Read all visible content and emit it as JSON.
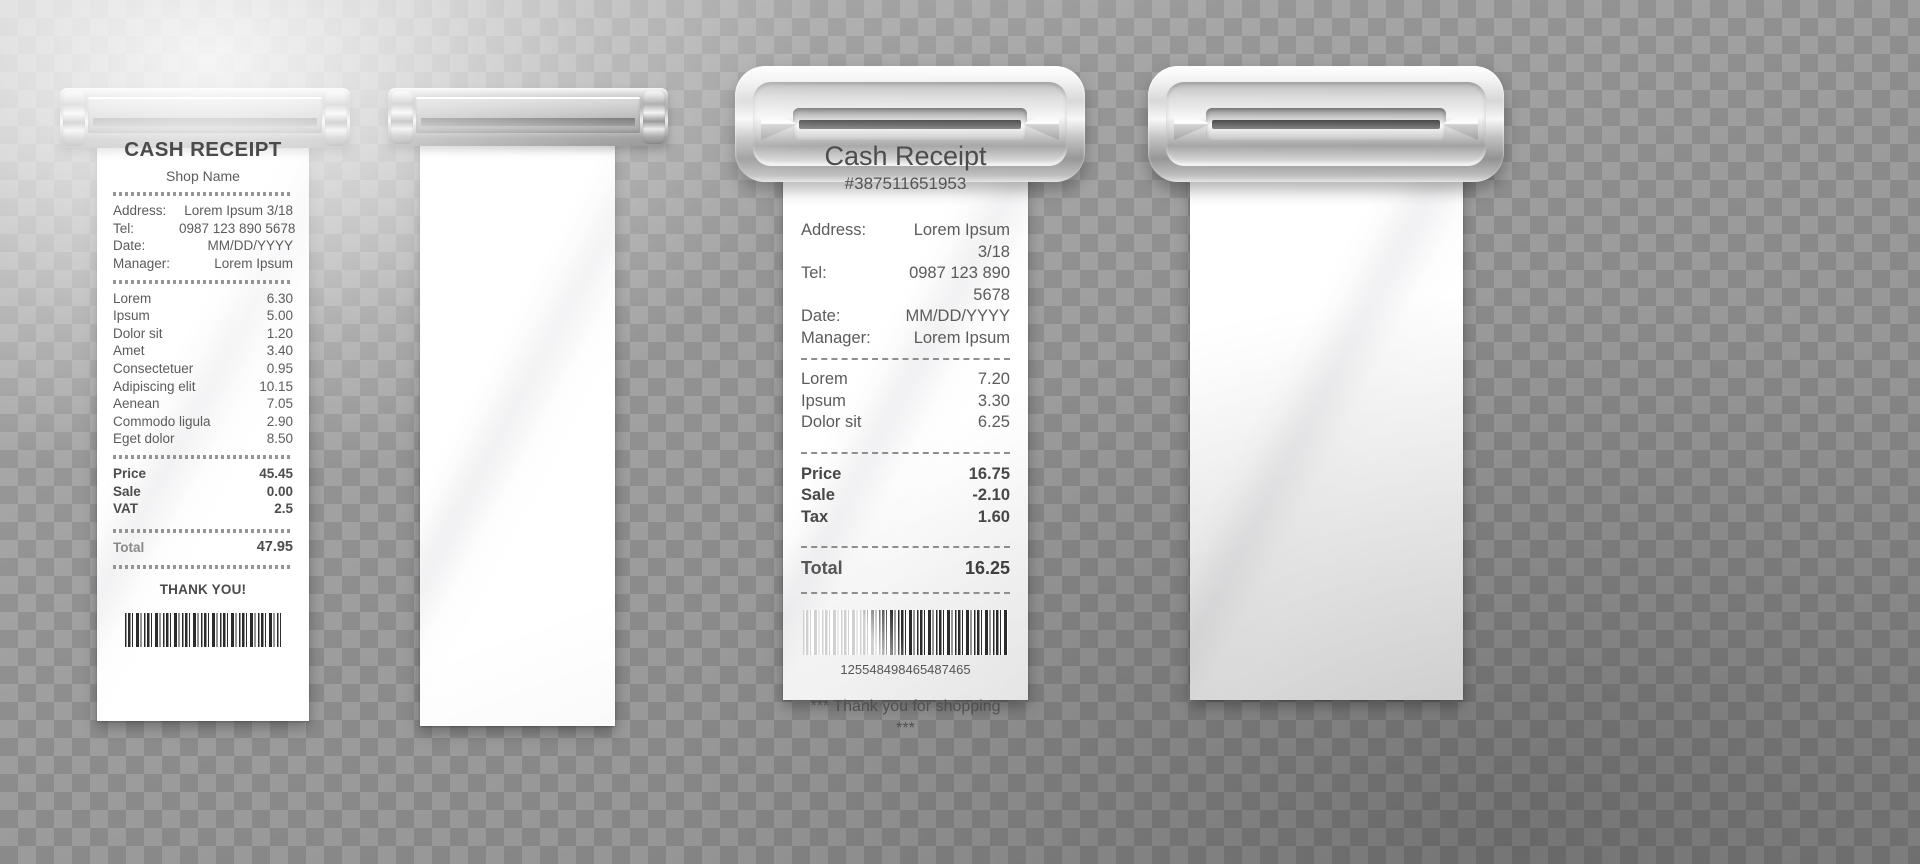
{
  "scene": {
    "title": "Cash receipt printer slots with printed and blank thermal paper",
    "background": "transparent-checkerboard",
    "accent_color": "#5b5b5b",
    "paper_color": "#ffffff",
    "chrome_color": "#bdbdbd"
  },
  "receipts": [
    {
      "id": "receipt-printed-bold",
      "slot_style": "thin-chrome-bar",
      "title": "CASH RECEIPT",
      "shop": "Shop Name",
      "info": [
        {
          "label": "Address:",
          "value": "Lorem Ipsum 3/18"
        },
        {
          "label": "Tel:",
          "value": "0987 123 890 5678"
        },
        {
          "label": "Date:",
          "value": "MM/DD/YYYY"
        },
        {
          "label": "Manager:",
          "value": "Lorem Ipsum"
        }
      ],
      "items": [
        {
          "name": "Lorem",
          "price": "6.30"
        },
        {
          "name": "Ipsum",
          "price": "5.00"
        },
        {
          "name": "Dolor sit",
          "price": "1.20"
        },
        {
          "name": "Amet",
          "price": "3.40"
        },
        {
          "name": "Consectetuer",
          "price": "0.95"
        },
        {
          "name": "Adipiscing elit",
          "price": "10.15"
        },
        {
          "name": "Aenean",
          "price": "7.05"
        },
        {
          "name": "Commodo ligula",
          "price": "2.90"
        },
        {
          "name": "Eget dolor",
          "price": "8.50"
        }
      ],
      "summary": [
        {
          "label": "Price",
          "value": "45.45"
        },
        {
          "label": "Sale",
          "value": "0.00"
        },
        {
          "label": "VAT",
          "value": "2.5"
        }
      ],
      "total": {
        "label": "Total",
        "value": "47.95"
      },
      "footer": "THANK YOU!",
      "barcode": true
    },
    {
      "id": "receipt-blank-thin-slot",
      "slot_style": "thin-chrome-bar",
      "blank": true
    },
    {
      "id": "receipt-printed-light",
      "slot_style": "thick-rounded-bezel",
      "title": "Cash Receipt",
      "number": "#387511651953",
      "info": [
        {
          "label": "Address:",
          "value": "Lorem Ipsum 3/18"
        },
        {
          "label": "Tel:",
          "value": "0987 123 890 5678"
        },
        {
          "label": "Date:",
          "value": "MM/DD/YYYY"
        },
        {
          "label": "Manager:",
          "value": "Lorem Ipsum"
        }
      ],
      "items": [
        {
          "name": "Lorem",
          "price": "7.20"
        },
        {
          "name": "Ipsum",
          "price": "3.30"
        },
        {
          "name": "Dolor sit",
          "price": "6.25"
        }
      ],
      "summary": [
        {
          "label": "Price",
          "value": "16.75"
        },
        {
          "label": "Sale",
          "value": "-2.10"
        },
        {
          "label": "Tax",
          "value": "1.60"
        }
      ],
      "total": {
        "label": "Total",
        "value": "16.25"
      },
      "barcode_number": "125548498465487465",
      "footer": "*** Thank you for shopping ***",
      "barcode": true
    },
    {
      "id": "receipt-blank-thick-slot",
      "slot_style": "thick-rounded-bezel",
      "blank": true
    }
  ]
}
